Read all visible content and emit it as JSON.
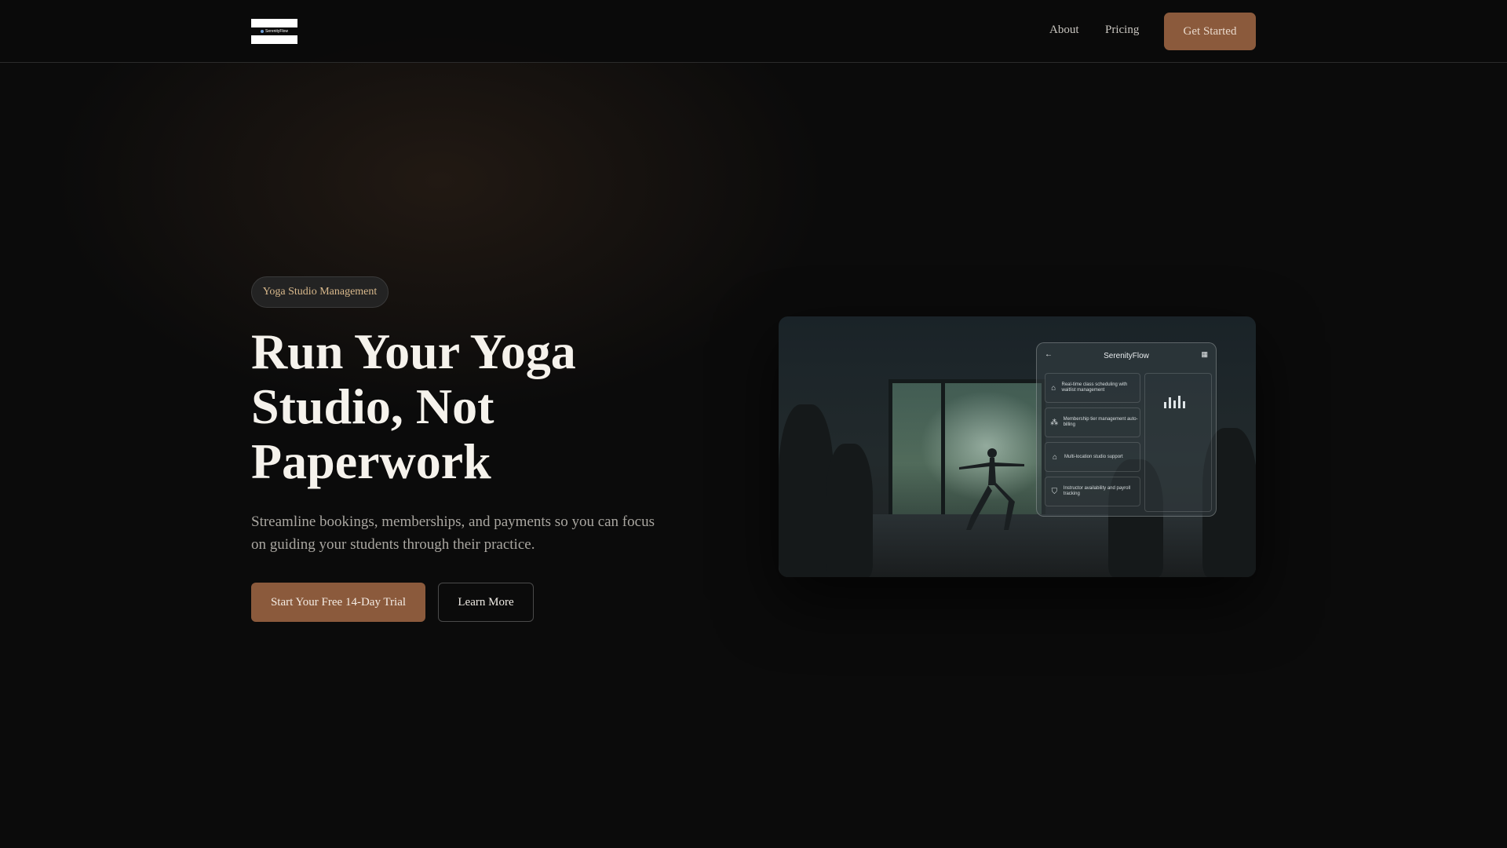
{
  "nav": {
    "logo_text": "SerenityFlow",
    "links": [
      "About",
      "Pricing"
    ],
    "cta": "Get Started"
  },
  "hero": {
    "badge": "Yoga Studio Management",
    "title_line1": "Run Your Yoga",
    "title_line2": "Studio, Not",
    "title_line3": "Paperwork",
    "subtitle": "Streamline bookings, memberships, and payments so you can focus on guiding your students through their practice.",
    "primary_cta": "Start Your Free 14-Day Trial",
    "secondary_cta": "Learn More"
  },
  "app_preview": {
    "title": "SerenityFlow",
    "features": [
      "Real-time class scheduling with waitlist management",
      "Membership tier management auto-billing",
      "Multi-location studio support",
      "Instructor availability and payroll tracking"
    ]
  },
  "colors": {
    "background": "#0b0b0b",
    "accent": "#8b5a3c",
    "badge_text": "#d9b98c"
  }
}
